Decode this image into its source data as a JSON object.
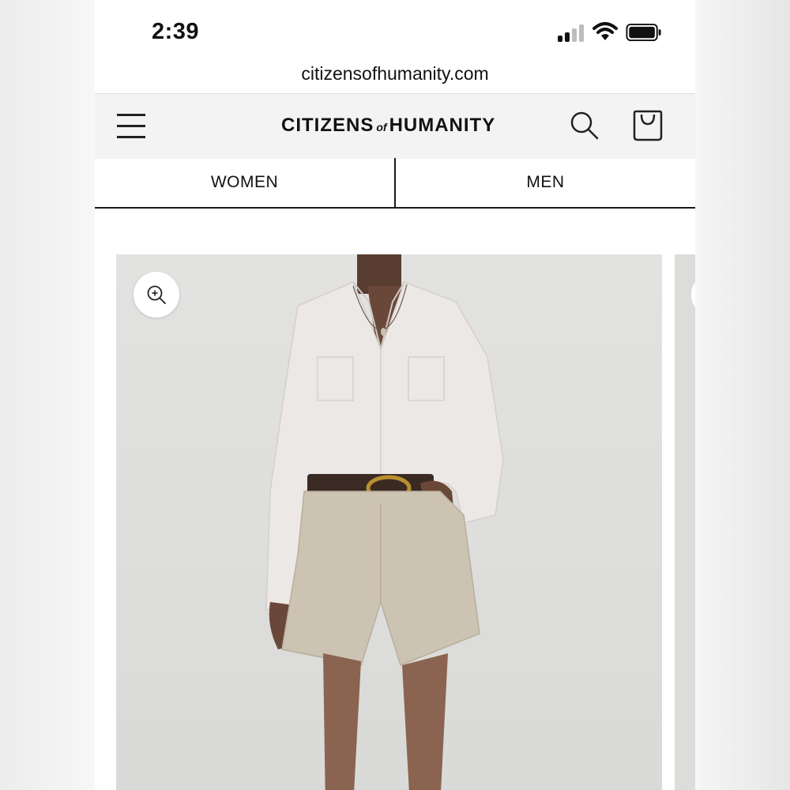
{
  "status_bar": {
    "time": "2:39",
    "icons": [
      "signal-icon",
      "wifi-icon",
      "battery-icon"
    ]
  },
  "browser": {
    "url": "citizensofhumanity.com"
  },
  "header": {
    "logo_left": "CITIZENS",
    "logo_of": "of",
    "logo_right": "HUMANITY",
    "icons": [
      "menu-icon",
      "search-icon",
      "bag-icon"
    ]
  },
  "tabs": [
    {
      "label": "WOMEN"
    },
    {
      "label": "MEN"
    }
  ],
  "product_gallery": {
    "zoom_icon": "zoom-in-icon",
    "colors": {
      "background": "#dededc",
      "shirt": "#ece8e6",
      "shorts": "#cdc3b3",
      "belt": "#3b2a24",
      "buckle": "#b8902e"
    }
  }
}
